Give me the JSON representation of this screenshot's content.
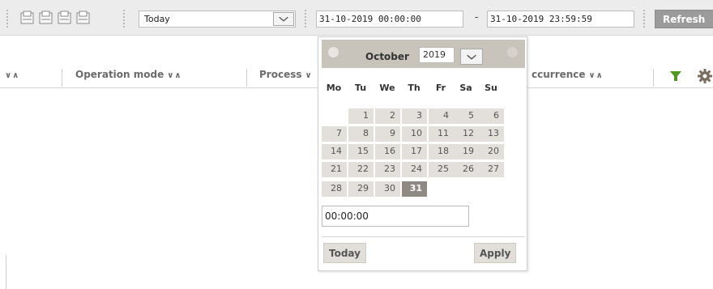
{
  "toolbar": {
    "icons": [
      "print-preview-icon",
      "print-icon",
      "print-setup-icon",
      "print-export-icon"
    ],
    "preset_value": "Today",
    "from_datetime": "31-10-2019 00:00:00",
    "separator": "-",
    "to_datetime": "31-10-2019 23:59:59",
    "refresh_label": "Refresh"
  },
  "columns": [
    {
      "label": "",
      "sort": "∨∧"
    },
    {
      "label": "Operation mode",
      "sort": "∨∧"
    },
    {
      "label": "Process",
      "sort": "∨"
    },
    {
      "label": "ccurrence",
      "sort": "∨∧"
    }
  ],
  "header_icons": [
    "filter-icon",
    "gear-icon"
  ],
  "calendar": {
    "month": "October",
    "year": "2019",
    "weekdays": [
      "Mo",
      "Tu",
      "We",
      "Th",
      "Fr",
      "Sa",
      "Su"
    ],
    "weeks": [
      [
        "",
        "1",
        "2",
        "3",
        "4",
        "5",
        "6"
      ],
      [
        "7",
        "8",
        "9",
        "10",
        "11",
        "12",
        "13"
      ],
      [
        "14",
        "15",
        "16",
        "17",
        "18",
        "19",
        "20"
      ],
      [
        "21",
        "22",
        "23",
        "24",
        "25",
        "26",
        "27"
      ],
      [
        "28",
        "29",
        "30",
        "31",
        "",
        "",
        ""
      ]
    ],
    "selected_day": "31",
    "time_value": "00:00:00",
    "today_label": "Today",
    "apply_label": "Apply"
  },
  "colors": {
    "filter": "#4f9a1e",
    "selected_day": "#8e8a83",
    "toolbar_bg": "#ececec"
  }
}
